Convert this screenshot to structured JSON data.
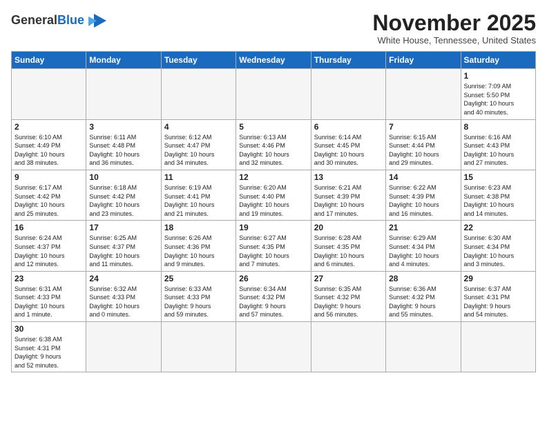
{
  "logo": {
    "general": "General",
    "blue": "Blue"
  },
  "title": "November 2025",
  "location": "White House, Tennessee, United States",
  "headers": [
    "Sunday",
    "Monday",
    "Tuesday",
    "Wednesday",
    "Thursday",
    "Friday",
    "Saturday"
  ],
  "weeks": [
    [
      {
        "date": "",
        "info": ""
      },
      {
        "date": "",
        "info": ""
      },
      {
        "date": "",
        "info": ""
      },
      {
        "date": "",
        "info": ""
      },
      {
        "date": "",
        "info": ""
      },
      {
        "date": "",
        "info": ""
      },
      {
        "date": "1",
        "info": "Sunrise: 7:09 AM\nSunset: 5:50 PM\nDaylight: 10 hours\nand 40 minutes."
      }
    ],
    [
      {
        "date": "2",
        "info": "Sunrise: 6:10 AM\nSunset: 4:49 PM\nDaylight: 10 hours\nand 38 minutes."
      },
      {
        "date": "3",
        "info": "Sunrise: 6:11 AM\nSunset: 4:48 PM\nDaylight: 10 hours\nand 36 minutes."
      },
      {
        "date": "4",
        "info": "Sunrise: 6:12 AM\nSunset: 4:47 PM\nDaylight: 10 hours\nand 34 minutes."
      },
      {
        "date": "5",
        "info": "Sunrise: 6:13 AM\nSunset: 4:46 PM\nDaylight: 10 hours\nand 32 minutes."
      },
      {
        "date": "6",
        "info": "Sunrise: 6:14 AM\nSunset: 4:45 PM\nDaylight: 10 hours\nand 30 minutes."
      },
      {
        "date": "7",
        "info": "Sunrise: 6:15 AM\nSunset: 4:44 PM\nDaylight: 10 hours\nand 29 minutes."
      },
      {
        "date": "8",
        "info": "Sunrise: 6:16 AM\nSunset: 4:43 PM\nDaylight: 10 hours\nand 27 minutes."
      }
    ],
    [
      {
        "date": "9",
        "info": "Sunrise: 6:17 AM\nSunset: 4:42 PM\nDaylight: 10 hours\nand 25 minutes."
      },
      {
        "date": "10",
        "info": "Sunrise: 6:18 AM\nSunset: 4:42 PM\nDaylight: 10 hours\nand 23 minutes."
      },
      {
        "date": "11",
        "info": "Sunrise: 6:19 AM\nSunset: 4:41 PM\nDaylight: 10 hours\nand 21 minutes."
      },
      {
        "date": "12",
        "info": "Sunrise: 6:20 AM\nSunset: 4:40 PM\nDaylight: 10 hours\nand 19 minutes."
      },
      {
        "date": "13",
        "info": "Sunrise: 6:21 AM\nSunset: 4:39 PM\nDaylight: 10 hours\nand 17 minutes."
      },
      {
        "date": "14",
        "info": "Sunrise: 6:22 AM\nSunset: 4:39 PM\nDaylight: 10 hours\nand 16 minutes."
      },
      {
        "date": "15",
        "info": "Sunrise: 6:23 AM\nSunset: 4:38 PM\nDaylight: 10 hours\nand 14 minutes."
      }
    ],
    [
      {
        "date": "16",
        "info": "Sunrise: 6:24 AM\nSunset: 4:37 PM\nDaylight: 10 hours\nand 12 minutes."
      },
      {
        "date": "17",
        "info": "Sunrise: 6:25 AM\nSunset: 4:37 PM\nDaylight: 10 hours\nand 11 minutes."
      },
      {
        "date": "18",
        "info": "Sunrise: 6:26 AM\nSunset: 4:36 PM\nDaylight: 10 hours\nand 9 minutes."
      },
      {
        "date": "19",
        "info": "Sunrise: 6:27 AM\nSunset: 4:35 PM\nDaylight: 10 hours\nand 7 minutes."
      },
      {
        "date": "20",
        "info": "Sunrise: 6:28 AM\nSunset: 4:35 PM\nDaylight: 10 hours\nand 6 minutes."
      },
      {
        "date": "21",
        "info": "Sunrise: 6:29 AM\nSunset: 4:34 PM\nDaylight: 10 hours\nand 4 minutes."
      },
      {
        "date": "22",
        "info": "Sunrise: 6:30 AM\nSunset: 4:34 PM\nDaylight: 10 hours\nand 3 minutes."
      }
    ],
    [
      {
        "date": "23",
        "info": "Sunrise: 6:31 AM\nSunset: 4:33 PM\nDaylight: 10 hours\nand 1 minute."
      },
      {
        "date": "24",
        "info": "Sunrise: 6:32 AM\nSunset: 4:33 PM\nDaylight: 10 hours\nand 0 minutes."
      },
      {
        "date": "25",
        "info": "Sunrise: 6:33 AM\nSunset: 4:33 PM\nDaylight: 9 hours\nand 59 minutes."
      },
      {
        "date": "26",
        "info": "Sunrise: 6:34 AM\nSunset: 4:32 PM\nDaylight: 9 hours\nand 57 minutes."
      },
      {
        "date": "27",
        "info": "Sunrise: 6:35 AM\nSunset: 4:32 PM\nDaylight: 9 hours\nand 56 minutes."
      },
      {
        "date": "28",
        "info": "Sunrise: 6:36 AM\nSunset: 4:32 PM\nDaylight: 9 hours\nand 55 minutes."
      },
      {
        "date": "29",
        "info": "Sunrise: 6:37 AM\nSunset: 4:31 PM\nDaylight: 9 hours\nand 54 minutes."
      }
    ],
    [
      {
        "date": "30",
        "info": "Sunrise: 6:38 AM\nSunset: 4:31 PM\nDaylight: 9 hours\nand 52 minutes."
      },
      {
        "date": "",
        "info": ""
      },
      {
        "date": "",
        "info": ""
      },
      {
        "date": "",
        "info": ""
      },
      {
        "date": "",
        "info": ""
      },
      {
        "date": "",
        "info": ""
      },
      {
        "date": "",
        "info": ""
      }
    ]
  ]
}
